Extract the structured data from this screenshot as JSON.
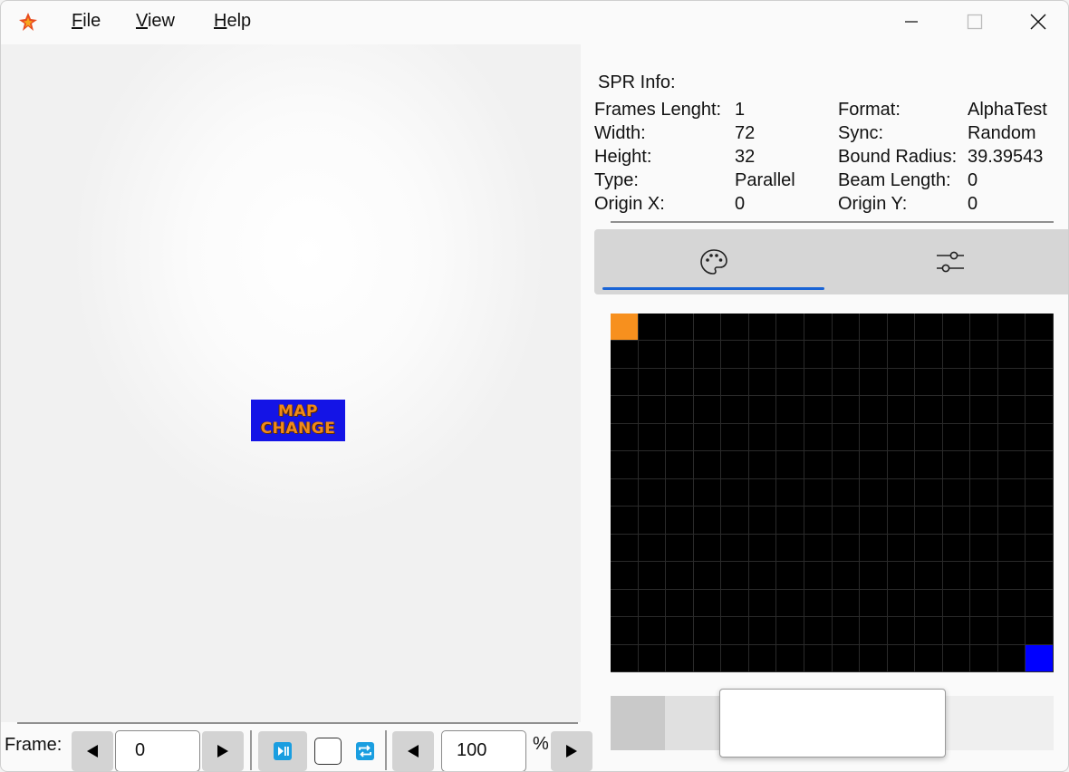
{
  "menu": {
    "file": {
      "underline": "F",
      "rest": "ile"
    },
    "view": {
      "underline": "V",
      "rest": "iew"
    },
    "help": {
      "underline": "H",
      "rest": "elp"
    }
  },
  "preview": {
    "sprite_line1": "MAP",
    "sprite_line2": "CHANGE"
  },
  "info": {
    "title": "SPR Info:",
    "frames_label": "Frames Lenght:",
    "frames_value": "1",
    "width_label": "Width:",
    "width_value": "72",
    "height_label": "Height:",
    "height_value": "32",
    "type_label": "Type:",
    "type_value": "Parallel",
    "originx_label": "Origin X:",
    "originx_value": "0",
    "format_label": "Format:",
    "format_value": "AlphaTest",
    "sync_label": "Sync:",
    "sync_value": "Random",
    "bound_label": "Bound Radius:",
    "bound_value": "39.39543",
    "beam_label": "Beam Length:",
    "beam_value": "0",
    "originy_label": "Origin Y:",
    "originy_value": "0"
  },
  "tabs": [
    {
      "icon": "palette-icon",
      "selected": true
    },
    {
      "icon": "sliders-icon",
      "selected": false
    }
  ],
  "palette": {
    "columns": 16,
    "rows": 13,
    "first_color": "#f7901e",
    "last_color": "#0000ff",
    "default_color": "#000000"
  },
  "bottom": {
    "frame_label": "Frame:",
    "frame_value": "0",
    "zoom_value": "100",
    "percent": "%"
  },
  "colors": {
    "accent": "#1a64d6",
    "play_icon": "#1a9ee0"
  }
}
